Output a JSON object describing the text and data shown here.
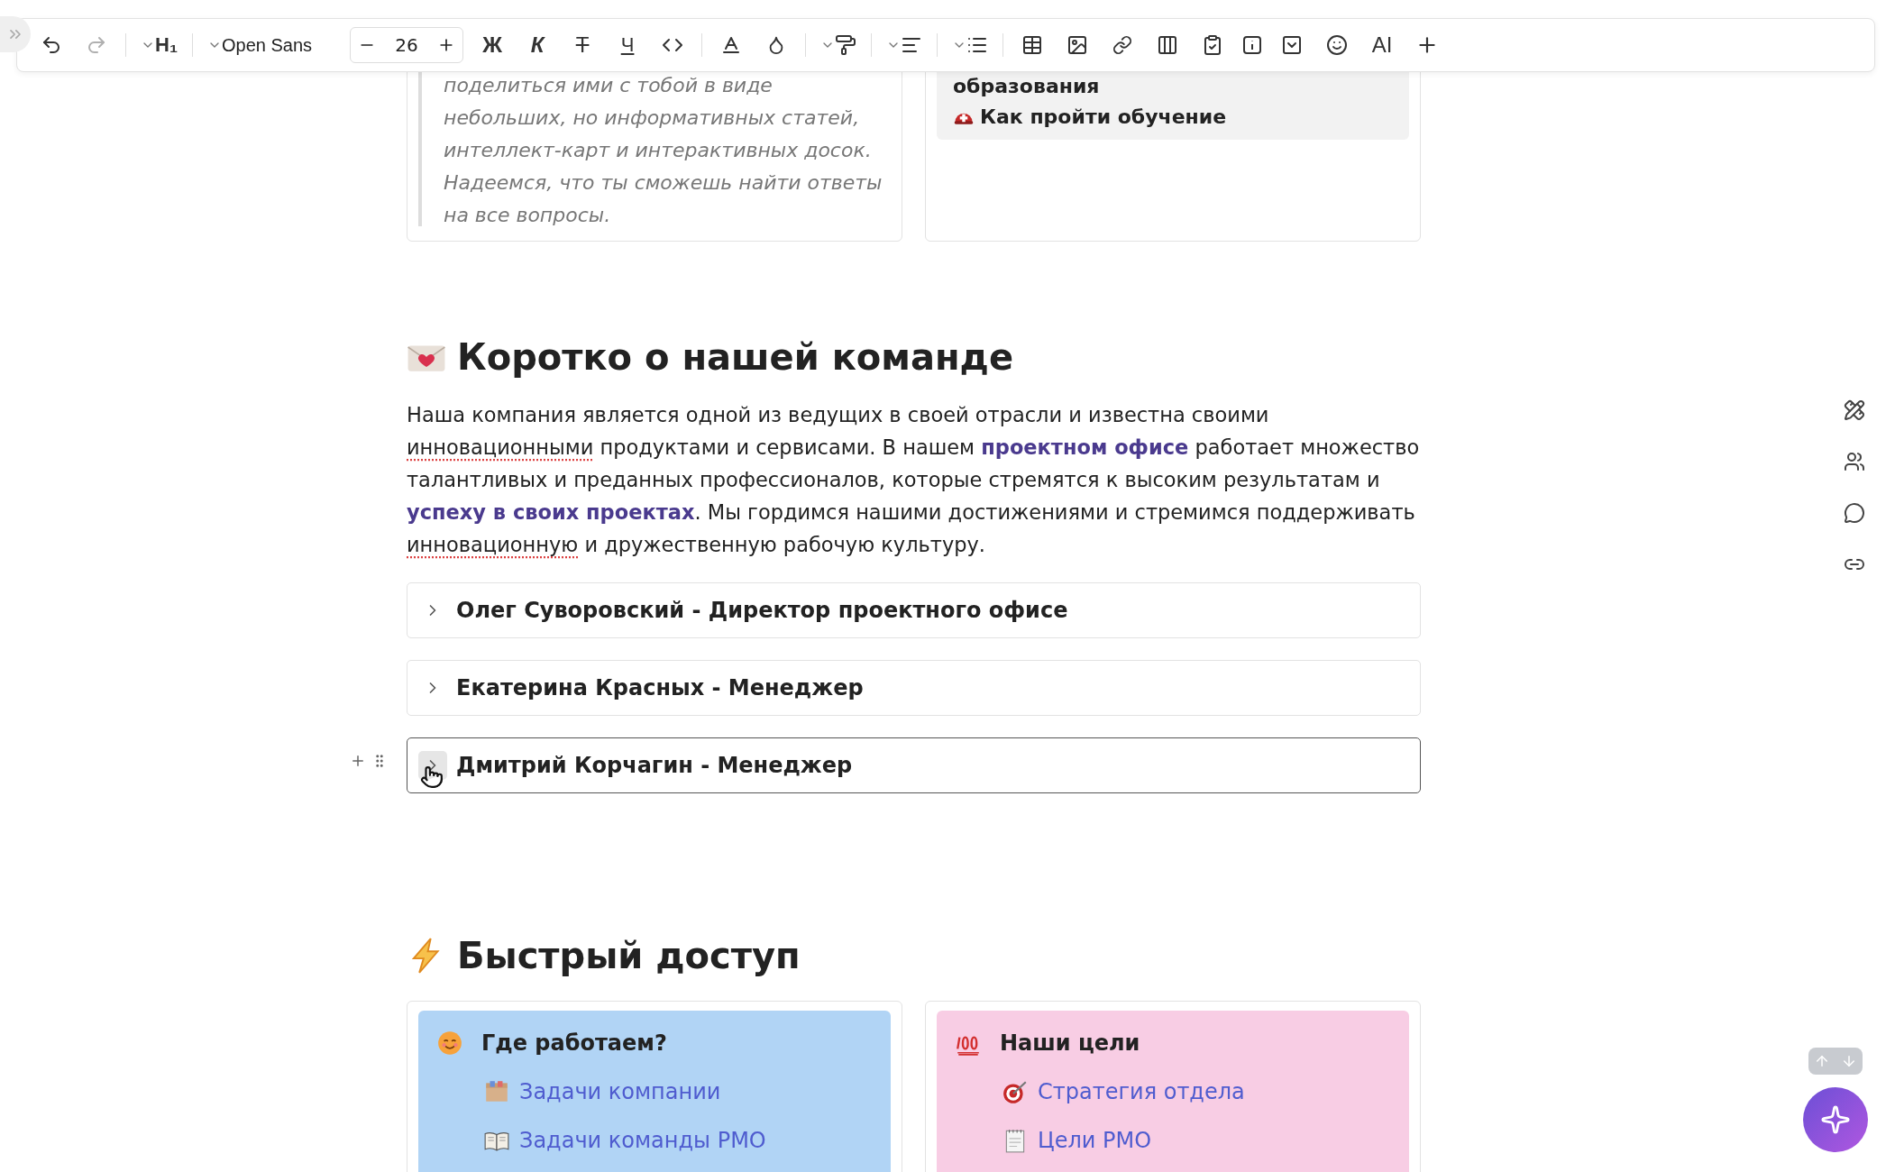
{
  "toolbar": {
    "heading_style": "H₁",
    "font": "Open Sans",
    "font_size": "26",
    "format_buttons": [
      "Ж",
      "К",
      "Т",
      "Ч"
    ],
    "ai_button": "AI"
  },
  "top_cards": {
    "quote": "поделиться ими с тобой в виде небольших, но информативных статей, интеллект-карт и интерактивных досок. Надеемся, что ты сможешь найти ответы на все вопросы.",
    "right_heading": "образования",
    "right_link": "Как пройти обучение"
  },
  "team_section": {
    "heading": "Коротко о нашей команде",
    "paragraph": [
      {
        "kind": "text",
        "text": "Наша компания является одной из ведущих в своей отрасли и известна своими "
      },
      {
        "kind": "misspelled",
        "text": "инновационными"
      },
      {
        "kind": "text",
        "text": " продуктами и сервисами. В нашем "
      },
      {
        "kind": "link",
        "text": "проектном офисе"
      },
      {
        "kind": "text",
        "text": " работает множество талантливых и преданных профессионалов, которые стремятся к высоким результатам и "
      },
      {
        "kind": "link",
        "text": "успеху в своих проектах"
      },
      {
        "kind": "text",
        "text": ". Мы гордимся нашими достижениями и стремимся поддерживать "
      },
      {
        "kind": "misspelled",
        "text": "инновационную"
      },
      {
        "kind": "text",
        "text": " и дружественную рабочую культуру."
      }
    ],
    "members": [
      {
        "title": "Олег Суворовский - Директор проектного офисе",
        "hovered": false
      },
      {
        "title": "Екатерина Красных - Менеджер",
        "hovered": false
      },
      {
        "title": "Дмитрий Корчагин - Менеджер",
        "hovered": true
      }
    ]
  },
  "quick_access": {
    "heading": "Быстрый доступ",
    "cards": [
      {
        "title": "Где работаем?",
        "color": "#b1d4f5",
        "links": [
          "Задачи компании",
          "Задачи команды PMO"
        ]
      },
      {
        "title": "Наши цели",
        "color": "#f8cde4",
        "links": [
          "Стратегия отдела",
          "Цели PMO"
        ]
      }
    ]
  }
}
